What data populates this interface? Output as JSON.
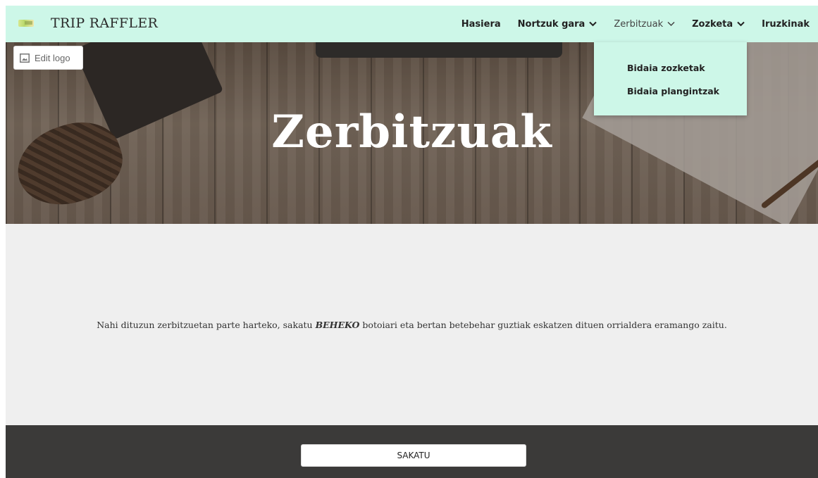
{
  "brand": {
    "name": "TRIP RAFFLER",
    "logo_icon": "logo-icon"
  },
  "nav": {
    "items": [
      {
        "label": "Hasiera",
        "has_dropdown": false
      },
      {
        "label": "Nortzuk gara",
        "has_dropdown": true
      },
      {
        "label": "Zerbitzuak",
        "has_dropdown": true,
        "active": true
      },
      {
        "label": "Zozketa",
        "has_dropdown": true
      },
      {
        "label": "Iruzkinak",
        "has_dropdown": false
      }
    ],
    "dropdown_items": [
      "Bidaia zozketak",
      "Bidaia plangintzak"
    ]
  },
  "edit_logo": {
    "label": "Edit logo",
    "icon": "image-icon"
  },
  "hero": {
    "title": "Zerbitzuak"
  },
  "content": {
    "text_before": "Nahi dituzun zerbitzuetan parte harteko, sakatu ",
    "text_bold": "BEHEKO",
    "text_after": " botoiari eta bertan betebehar guztiak eskatzen dituen orrialdera eramango zaitu."
  },
  "footer": {
    "button_label": "SAKATU"
  },
  "colors": {
    "nav_background": "#cdf7e8",
    "footer_background": "#3b3a39",
    "content_background": "#efefef",
    "hero_title": "#ffffff"
  }
}
